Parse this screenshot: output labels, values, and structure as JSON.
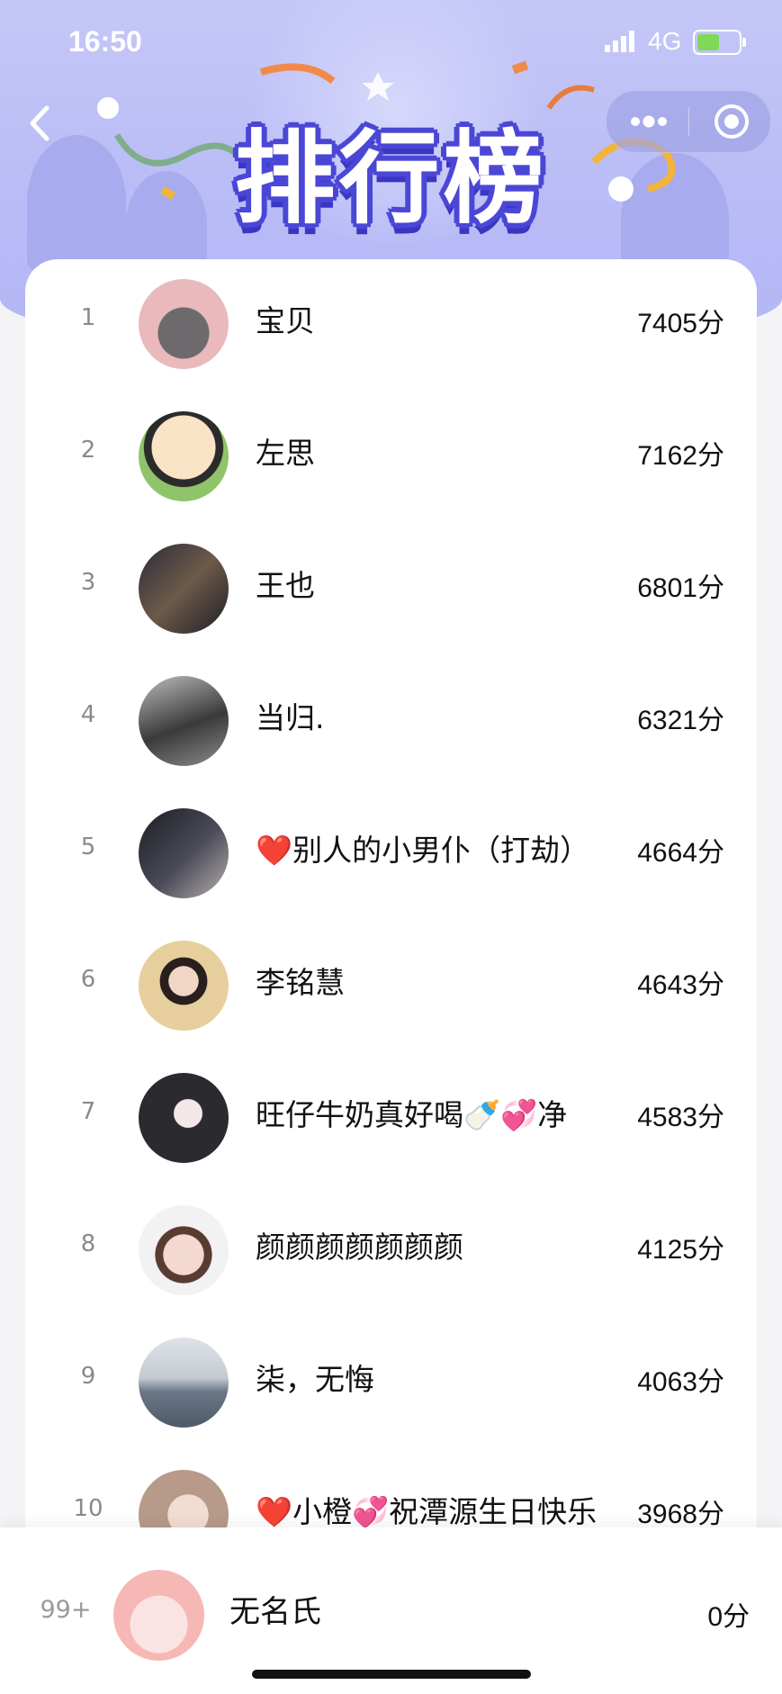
{
  "status_bar": {
    "time": "16:50",
    "network": "4G"
  },
  "header": {
    "title": "排行榜"
  },
  "ranking": [
    {
      "rank": "1",
      "name": "宝贝",
      "score": "7405分"
    },
    {
      "rank": "2",
      "name": "左思",
      "score": "7162分"
    },
    {
      "rank": "3",
      "name": "王也",
      "score": "6801分"
    },
    {
      "rank": "4",
      "name": "当归.",
      "score": "6321分"
    },
    {
      "rank": "5",
      "name": "❤️别人的小男仆（打劫）",
      "score": "4664分"
    },
    {
      "rank": "6",
      "name": "李铭慧",
      "score": "4643分"
    },
    {
      "rank": "7",
      "name": "旺仔牛奶真好喝🍼💞净",
      "score": "4583分"
    },
    {
      "rank": "8",
      "name": "颜颜颜颜颜颜颜",
      "score": "4125分"
    },
    {
      "rank": "9",
      "name": "柒，无悔",
      "score": "4063分"
    },
    {
      "rank": "10",
      "name": "❤️小橙💞祝潭源生日快乐",
      "score": "3968分"
    }
  ],
  "me": {
    "rank": "99+",
    "name": "无名氏",
    "score": "0分"
  },
  "colors": {
    "header_bg": "#b9bcf6",
    "title_outline": "#4b47d6"
  }
}
